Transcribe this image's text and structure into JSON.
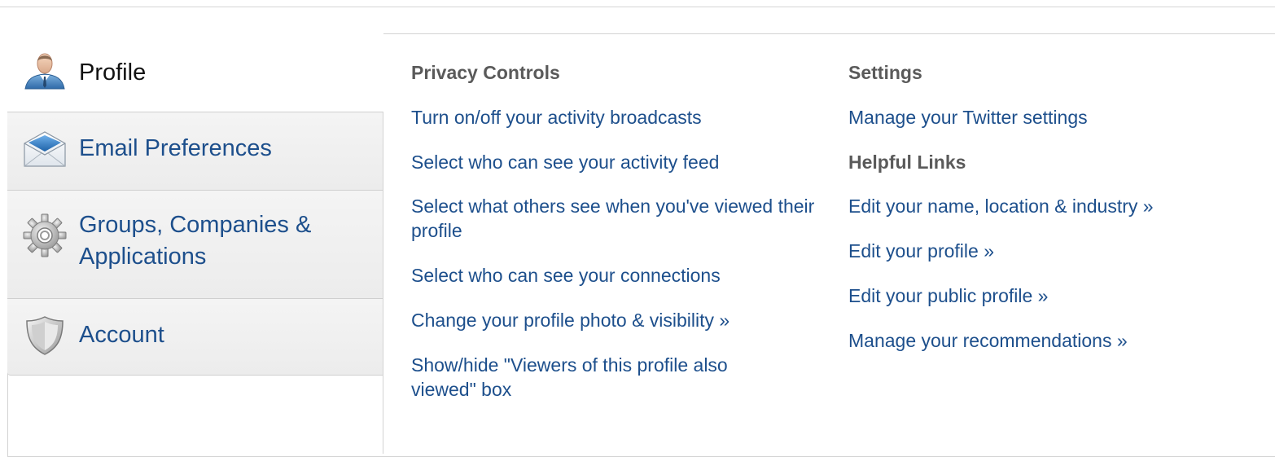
{
  "nav": {
    "items": [
      {
        "id": "profile",
        "label": "Profile",
        "icon": "user-profile-icon",
        "active": true
      },
      {
        "id": "email",
        "label": "Email Preferences",
        "icon": "envelope-icon",
        "active": false
      },
      {
        "id": "groups",
        "label": "Groups, Companies & Applications",
        "icon": "gear-icon",
        "active": false
      },
      {
        "id": "account",
        "label": "Account",
        "icon": "shield-icon",
        "active": false
      }
    ]
  },
  "privacy": {
    "heading": "Privacy Controls",
    "links": [
      "Turn on/off your activity broadcasts",
      "Select who can see your activity feed",
      "Select what others see when you've viewed their profile",
      "Select who can see your connections",
      "Change your profile photo & visibility »",
      "Show/hide \"Viewers of this profile also viewed\" box"
    ]
  },
  "settings": {
    "heading": "Settings",
    "links": [
      "Manage your Twitter settings"
    ]
  },
  "helpful": {
    "heading": "Helpful Links",
    "links": [
      "Edit your name, location & industry »",
      "Edit your profile »",
      "Edit your public profile »",
      "Manage your recommendations »"
    ]
  },
  "colors": {
    "link": "#1d4f8c",
    "heading": "#5a5a5a",
    "border": "#d3d3d3"
  }
}
